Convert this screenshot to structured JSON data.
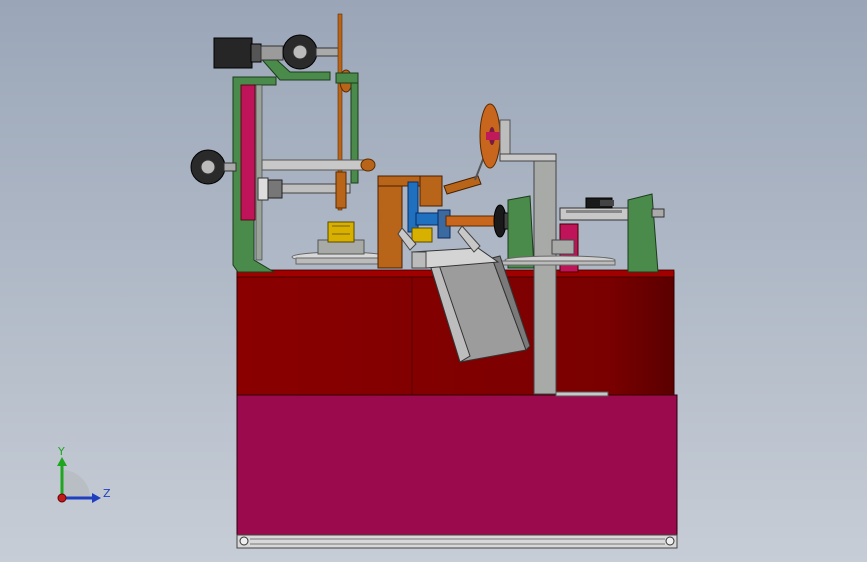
{
  "viewport": {
    "background_top": "#9aa6b8",
    "background_bottom": "#c7cdd6"
  },
  "triad": {
    "y_label": "Y",
    "z_label": "Z",
    "y_color": "#1fa51f",
    "z_color": "#1f3fbf",
    "origin_color": "#c01a1a"
  },
  "colors": {
    "base_cabinet": "#9a0a4c",
    "table_frame": "#8a0000",
    "green_frame": "#4a8a4a",
    "magenta_panel": "#c0145a",
    "orange_bracket": "#b8651a",
    "grey_post": "#a8aaa8",
    "yellow_part": "#d8b000",
    "blue_part": "#2070c0",
    "dark_part": "#222222"
  }
}
